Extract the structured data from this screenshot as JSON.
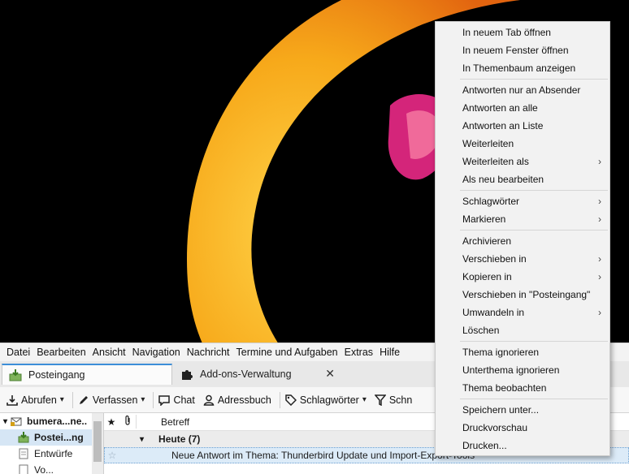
{
  "menubar": {
    "items": [
      "Datei",
      "Bearbeiten",
      "Ansicht",
      "Navigation",
      "Nachricht",
      "Termine und Aufgaben",
      "Extras",
      "Hilfe"
    ]
  },
  "tabs": [
    {
      "label": "Posteingang",
      "active": true
    },
    {
      "label": "Add-ons-Verwaltung",
      "active": false
    }
  ],
  "toolbar": {
    "abrufen": "Abrufen",
    "verfassen": "Verfassen",
    "chat": "Chat",
    "adressbuch": "Adressbuch",
    "schlagwoerter": "Schlagwörter",
    "filter": "Schn"
  },
  "folders": [
    {
      "label": "bumera...ne..",
      "type": "account"
    },
    {
      "label": "Postei...ng",
      "type": "inbox",
      "selected": true
    },
    {
      "label": "Entwürfe",
      "type": "drafts"
    },
    {
      "label": "Vo...",
      "type": "other"
    }
  ],
  "thread": {
    "header_subject": "Betreff",
    "group_label": "Heute (7)",
    "rows": [
      {
        "subject": "Neue Antwort im Thema: Thunderbird Update und Import-Export-Tools"
      }
    ]
  },
  "context_menu": {
    "groups": [
      [
        {
          "label": "In neuem Tab öffnen",
          "submenu": false
        },
        {
          "label": "In neuem Fenster öffnen",
          "submenu": false
        },
        {
          "label": "In Themenbaum anzeigen",
          "submenu": false
        }
      ],
      [
        {
          "label": "Antworten nur an Absender",
          "submenu": false
        },
        {
          "label": "Antworten an alle",
          "submenu": false
        },
        {
          "label": "Antworten an Liste",
          "submenu": false
        },
        {
          "label": "Weiterleiten",
          "submenu": false
        },
        {
          "label": "Weiterleiten als",
          "submenu": true
        },
        {
          "label": "Als neu bearbeiten",
          "submenu": false
        }
      ],
      [
        {
          "label": "Schlagwörter",
          "submenu": true
        },
        {
          "label": "Markieren",
          "submenu": true
        }
      ],
      [
        {
          "label": "Archivieren",
          "submenu": false
        },
        {
          "label": "Verschieben in",
          "submenu": true
        },
        {
          "label": "Kopieren in",
          "submenu": true
        },
        {
          "label": "Verschieben in \"Posteingang\"",
          "submenu": false
        },
        {
          "label": "Umwandeln in",
          "submenu": true
        },
        {
          "label": "Löschen",
          "submenu": false
        }
      ],
      [
        {
          "label": "Thema ignorieren",
          "submenu": false
        },
        {
          "label": "Unterthema ignorieren",
          "submenu": false
        },
        {
          "label": "Thema beobachten",
          "submenu": false
        }
      ],
      [
        {
          "label": "Speichern unter...",
          "submenu": false
        },
        {
          "label": "Druckvorschau",
          "submenu": false
        },
        {
          "label": "Drucken...",
          "submenu": false
        }
      ]
    ]
  },
  "colors": {
    "accent": "#3c8ed8",
    "selection": "#d6e6f5",
    "wallpaper_bg": "#000000",
    "wallpaper_ring": "#f7b21b"
  }
}
